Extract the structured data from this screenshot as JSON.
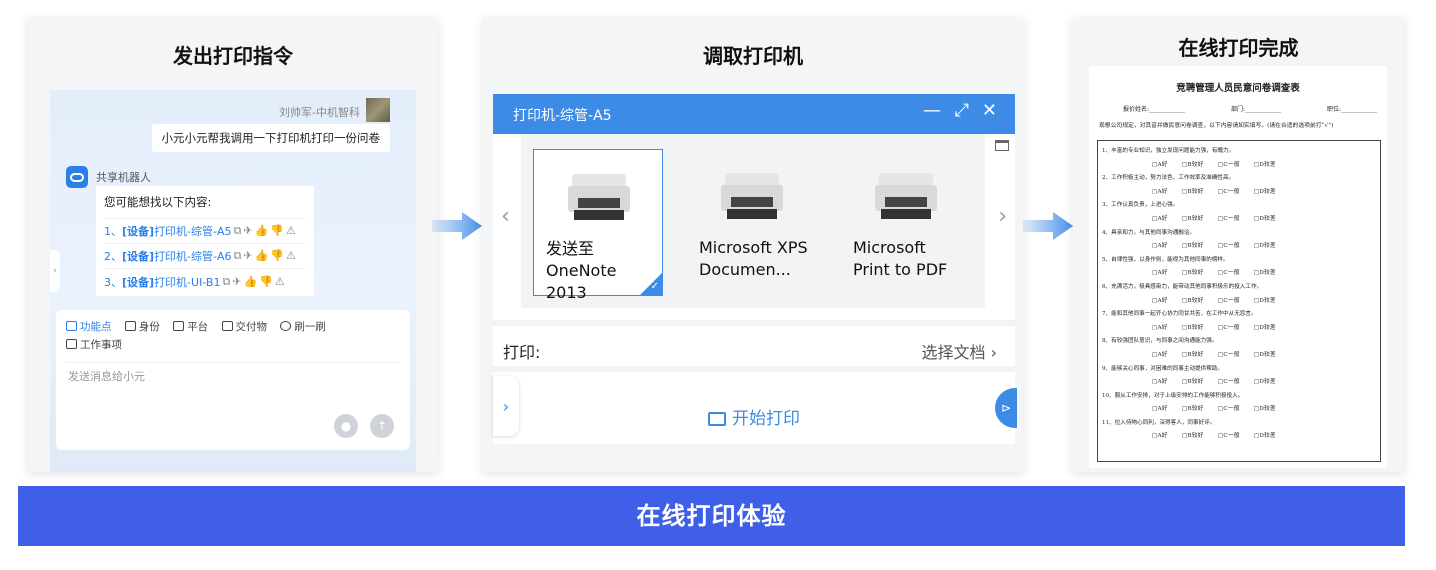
{
  "steps": {
    "step1_title": "发出打印指令",
    "step2_title": "调取打印机",
    "step3_title": "在线打印完成"
  },
  "chat": {
    "user_name": "刘帅军-中机智科",
    "user_message": "小元小元帮我调用一下打印机打印一份问卷",
    "bot_name": "共享机器人",
    "bot_question": "您可能想找以下内容:",
    "results": [
      {
        "index": "1、",
        "tag": "[设备]",
        "label": "打印机-综管-A5"
      },
      {
        "index": "2、",
        "tag": "[设备]",
        "label": "打印机-综管-A6"
      },
      {
        "index": "3、",
        "tag": "[设备]",
        "label": "打印机-UI-B1"
      }
    ],
    "tools": [
      "功能点",
      "身份",
      "平台",
      "交付物",
      "刷一刷",
      "工作事项"
    ],
    "input_placeholder": "发送消息给小元"
  },
  "printer_dialog": {
    "title": "打印机-综管-A5",
    "printers": [
      {
        "name": "发送至 OneNote 2013",
        "selected": true
      },
      {
        "name": "Microsoft XPS Documen...",
        "selected": false
      },
      {
        "name": "Microsoft Print to PDF",
        "selected": false
      }
    ],
    "print_label": "打印:",
    "choose_doc": "选择文档",
    "start_print": "开始打印"
  },
  "document": {
    "title": "竞聘管理人员民意问卷调查表",
    "fields": [
      "报价姓名:",
      "部门:",
      "职位:"
    ],
    "intro": "现根公司规定，对其昔并做民意问卷调查，以下内容请如实填写。(请在合适的选项前打“√”)",
    "options": "□A好 □B较好 □C一般 □D较差",
    "questions": [
      "1、丰富的专业知识，独立发现问题能力强，有魄力。",
      "2、工作积极主动，努力法色，工作效率及准确性高。",
      "3、工作认真负责，上进心强。",
      "4、具亲和力，与其他同事沟通融洽。",
      "5、自律性强，以身作则，能视为其他同事的榜样。",
      "6、充满活力，极具感染力，能带动其他同事积极乐的投入工作。",
      "7、能和其他同事一起齐心协力同甘共苦，在工作中从无怨言。",
      "8、有较强团队意识，与同事之间沟通能力强。",
      "9、能够关心同事，对困难的同事主动提供帮助。",
      "10、服从工作安排，对于上级安排的工作能够积极投入。",
      "11、拉入待物心同利，深得客人，同事好评。"
    ]
  },
  "banner_text": "在线打印体验",
  "colors": {
    "accent": "#3c8ce7",
    "banner": "#3f5fe8",
    "arrow": "#4a90e8"
  }
}
